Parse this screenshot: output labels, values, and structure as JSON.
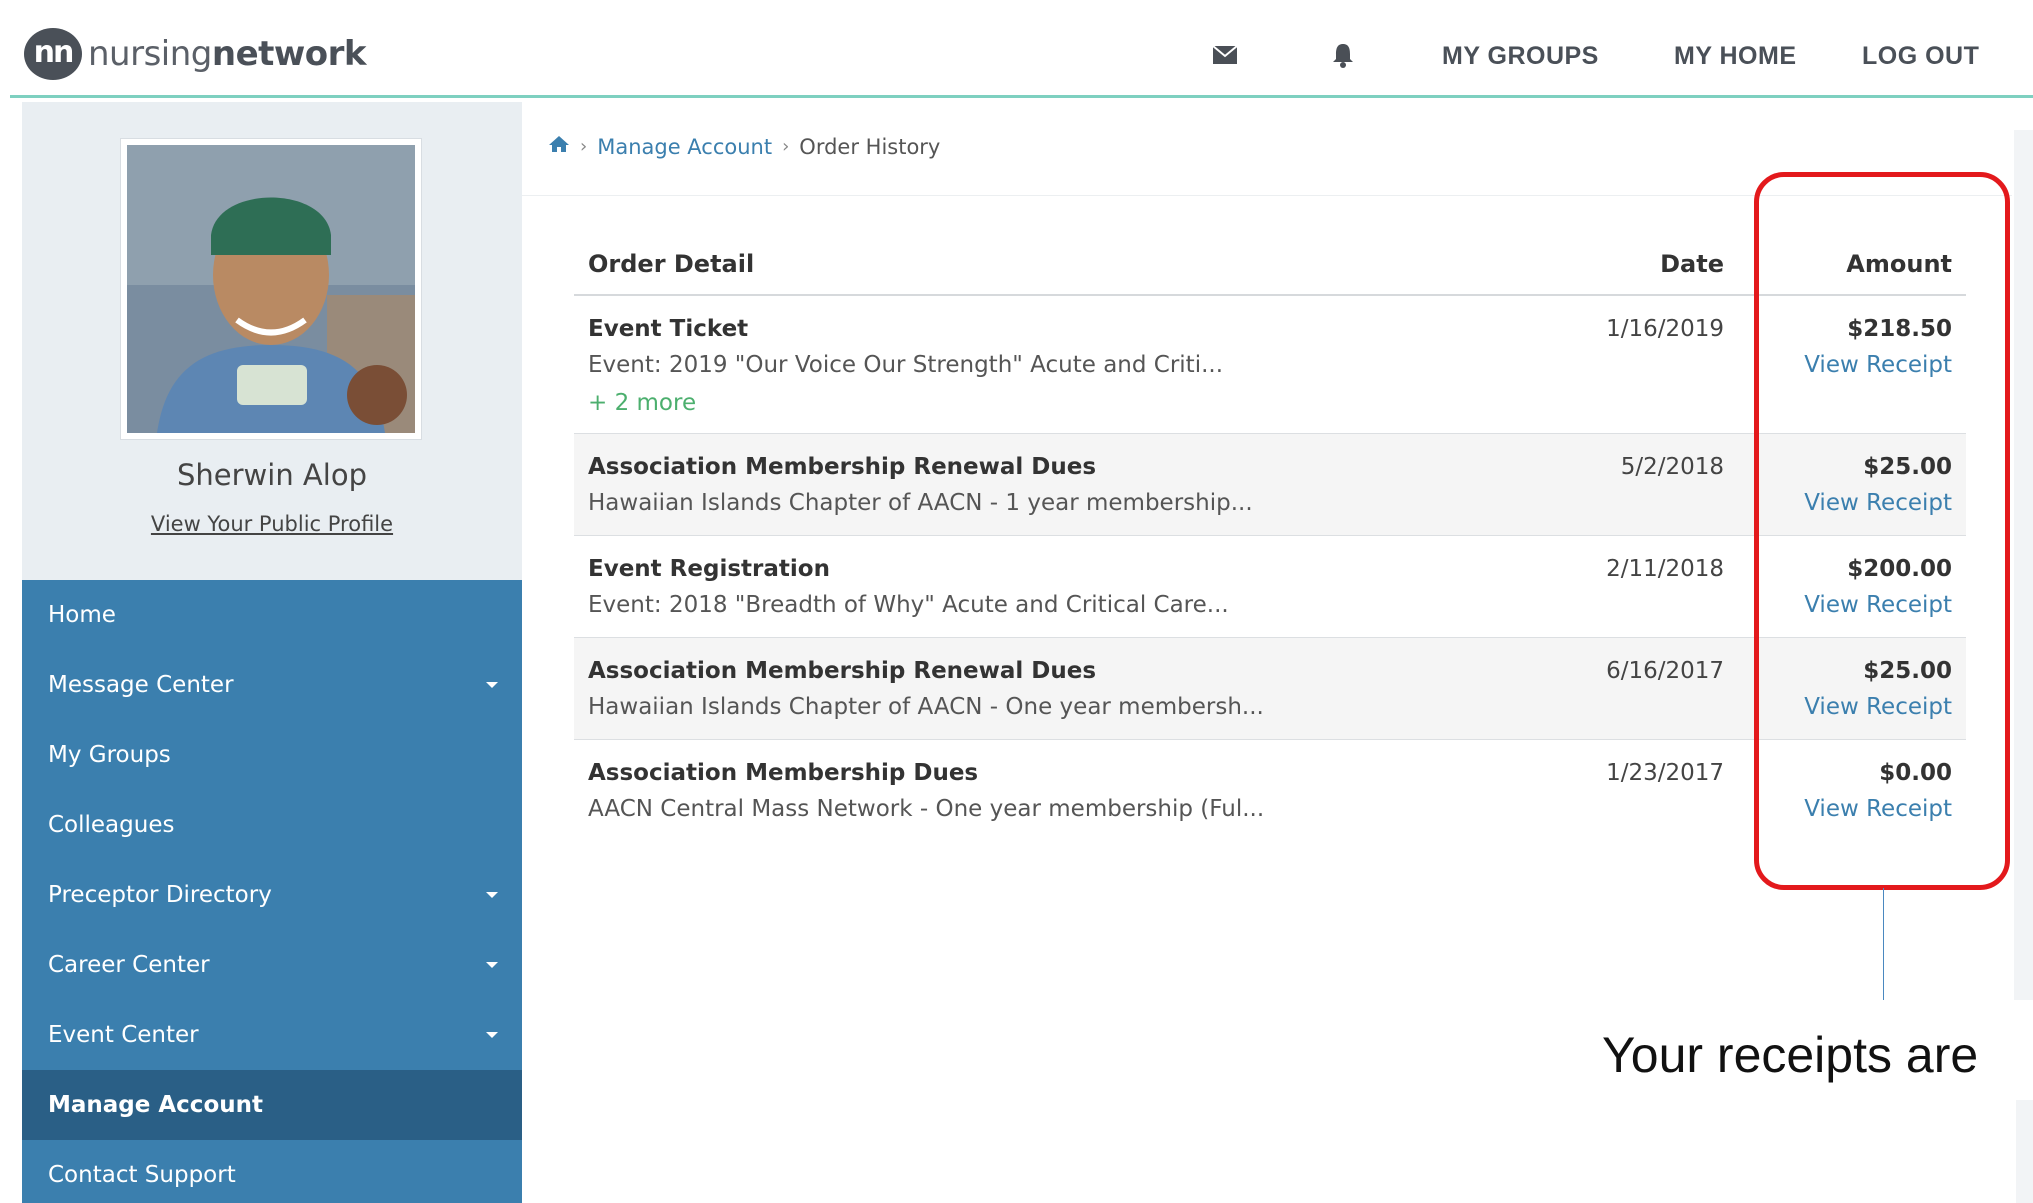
{
  "header": {
    "logo_mark": "nn",
    "logo_text_light": "nursing",
    "logo_text_bold": "network",
    "nav": {
      "mail_icon": "envelope-icon",
      "bell_icon": "bell-icon",
      "my_groups": "MY GROUPS",
      "my_home": "MY HOME",
      "log_out": "LOG OUT"
    }
  },
  "sidebar": {
    "profile_name": "Sherwin Alop",
    "profile_link": "View Your Public Profile",
    "menu": [
      {
        "label": "Home",
        "has_dropdown": false
      },
      {
        "label": "Message Center",
        "has_dropdown": true
      },
      {
        "label": "My Groups",
        "has_dropdown": false
      },
      {
        "label": "Colleagues",
        "has_dropdown": false
      },
      {
        "label": "Preceptor Directory",
        "has_dropdown": true
      },
      {
        "label": "Career Center",
        "has_dropdown": true
      },
      {
        "label": "Event Center",
        "has_dropdown": true
      },
      {
        "label": "Manage Account",
        "has_dropdown": false,
        "active": true
      },
      {
        "label": "Contact Support",
        "has_dropdown": false
      }
    ]
  },
  "breadcrumb": {
    "home_icon": "home-icon",
    "link": "Manage Account",
    "current": "Order History"
  },
  "table": {
    "headers": {
      "detail": "Order Detail",
      "date": "Date",
      "amount": "Amount"
    },
    "rows": [
      {
        "title": "Event Ticket",
        "desc": "Event: 2019 \"Our Voice Our Strength\" Acute and Criti...",
        "more": "+ 2 more",
        "date": "1/16/2019",
        "amount": "$218.50",
        "receipt": "View Receipt"
      },
      {
        "title": "Association Membership Renewal Dues",
        "desc": "Hawaiian Islands Chapter of AACN - 1 year membership...",
        "date": "5/2/2018",
        "amount": "$25.00",
        "receipt": "View Receipt"
      },
      {
        "title": "Event Registration",
        "desc": "Event: 2018 \"Breadth of Why\" Acute and Critical Care...",
        "date": "2/11/2018",
        "amount": "$200.00",
        "receipt": "View Receipt"
      },
      {
        "title": "Association Membership Renewal Dues",
        "desc": "Hawaiian Islands Chapter of AACN - One year membersh...",
        "date": "6/16/2017",
        "amount": "$25.00",
        "receipt": "View Receipt"
      },
      {
        "title": "Association Membership Dues",
        "desc": "AACN Central Mass Network - One year membership (Ful...",
        "date": "1/23/2017",
        "amount": "$0.00",
        "receipt": "View Receipt"
      }
    ]
  },
  "annotation": {
    "callout_text": "Your receipts are",
    "box_color": "#e3191c"
  },
  "colors": {
    "brand_blue": "#3b7fae",
    "menu_active": "#2a5f86",
    "accent_teal": "#7ed0c0",
    "more_green": "#4caf6e"
  }
}
